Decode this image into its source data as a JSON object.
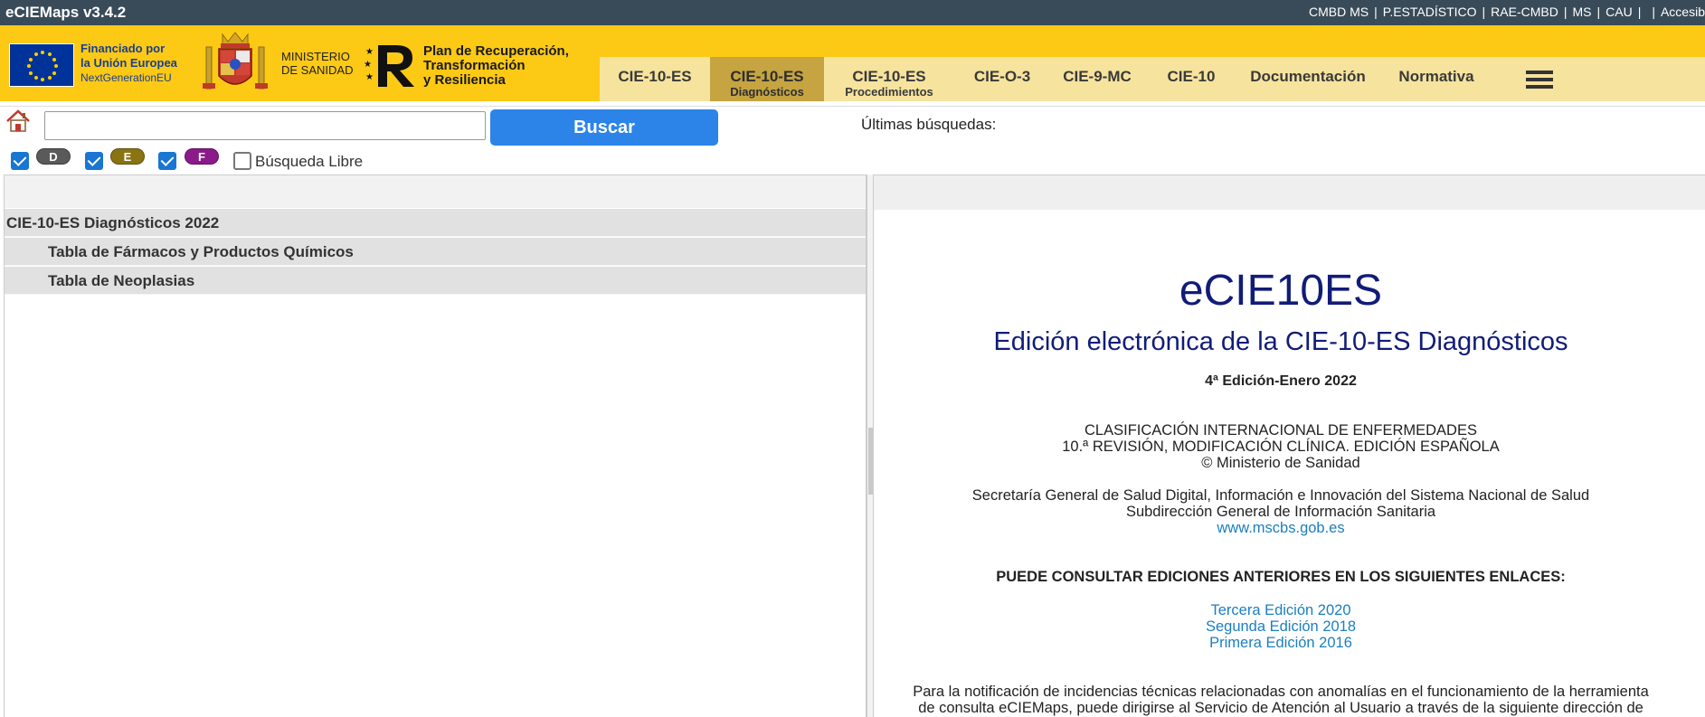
{
  "app": {
    "title": "eCIEMaps v3.4.2"
  },
  "top_links": [
    "CMBD MS",
    "P.ESTADÍSTICO",
    "RAE-CMBD",
    "MS",
    "CAU",
    "",
    "Accesib"
  ],
  "header": {
    "eu": {
      "line1": "Financiado por",
      "line2": "la Unión Europea",
      "line3": "NextGenerationEU"
    },
    "ministerio": {
      "line1": "MINISTERIO",
      "line2": "DE SANIDAD"
    },
    "prtr": {
      "line1": "Plan de Recuperación,",
      "line2": "Transformación",
      "line3": "y Resiliencia"
    }
  },
  "nav": {
    "tabs": [
      {
        "label": "CIE-10-ES",
        "sub": ""
      },
      {
        "label": "CIE-10-ES",
        "sub": "Diagnósticos"
      },
      {
        "label": "CIE-10-ES",
        "sub": "Procedimientos"
      },
      {
        "label": "CIE-O-3",
        "sub": ""
      },
      {
        "label": "CIE-9-MC",
        "sub": ""
      },
      {
        "label": "CIE-10",
        "sub": ""
      },
      {
        "label": "Documentación",
        "sub": ""
      },
      {
        "label": "Normativa",
        "sub": ""
      }
    ],
    "active_index": 1
  },
  "search": {
    "value": "",
    "button_label": "Buscar",
    "recent_label": "Últimas búsquedas:"
  },
  "filters": {
    "pills": [
      {
        "label": "D",
        "checked": true,
        "color": "#5a5a5a"
      },
      {
        "label": "E",
        "checked": true,
        "color": "#8a7312"
      },
      {
        "label": "F",
        "checked": true,
        "color": "#8b1a8b"
      }
    ],
    "libre_label": "Búsqueda Libre",
    "libre_checked": false
  },
  "tree": {
    "root": "CIE-10-ES Diagnósticos 2022",
    "children": [
      "Tabla de Fármacos y Productos Químicos",
      "Tabla de Neoplasias"
    ]
  },
  "content": {
    "title": "eCIE10ES",
    "subtitle": "Edición electrónica de la CIE-10-ES Diagnósticos",
    "edition": "4ª Edición-Enero 2022",
    "classification": [
      "CLASIFICACIÓN INTERNACIONAL DE ENFERMEDADES",
      "10.ª REVISIÓN, MODIFICACIÓN CLÍNICA. EDICIÓN ESPAÑOLA",
      "© Ministerio de Sanidad"
    ],
    "org": [
      "Secretaría General de Salud Digital, Información e Innovación del Sistema Nacional de Salud",
      "Subdirección General de Información Sanitaria"
    ],
    "website": "www.mscbs.gob.es",
    "consult_heading": "PUEDE CONSULTAR EDICIONES ANTERIORES EN LOS SIGUIENTES ENLACES:",
    "previous_editions": [
      "Tercera Edición 2020",
      "Segunda Edición 2018",
      "Primera Edición 2016"
    ],
    "notice": [
      "Para la notificación de incidencias técnicas relacionadas con anomalías en el funcionamiento de la herramienta",
      "de consulta eCIEMaps, puede dirigirse al Servicio de Atención al Usuario a través de la siguiente dirección de"
    ]
  },
  "colors": {
    "topbar": "#394b59",
    "header": "#fcc915",
    "active_tab": "#c5a441",
    "search_button": "#2c84e8",
    "title": "#111c78",
    "link": "#1a7fc1"
  }
}
